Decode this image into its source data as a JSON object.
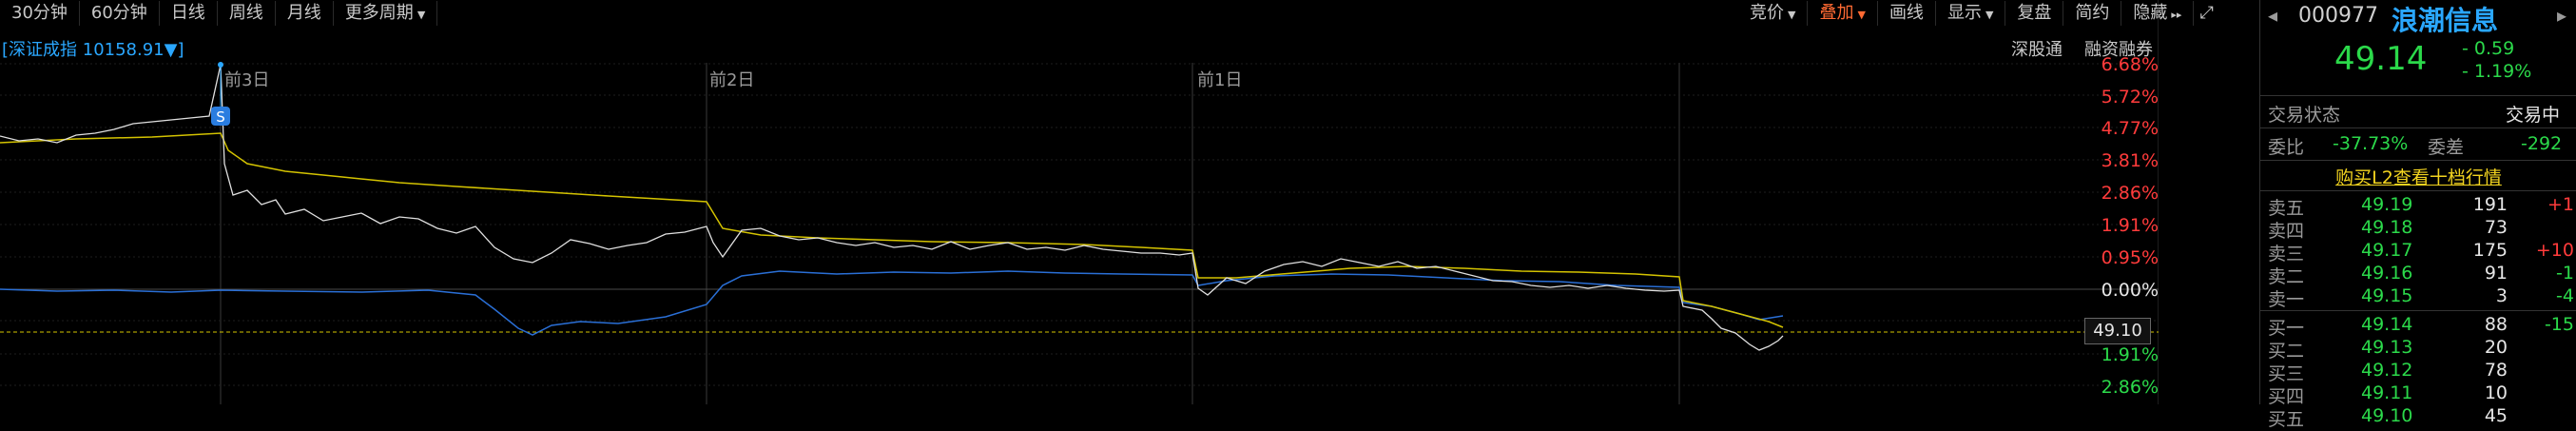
{
  "toolbar_left": [
    "30分钟",
    "60分钟",
    "日线",
    "周线",
    "月线",
    "更多周期"
  ],
  "toolbar_right": [
    "竞价",
    "叠加",
    "画线",
    "显示",
    "复盘",
    "简约",
    "隐藏"
  ],
  "index_label": "[深证成指 10158.91▼]",
  "links": [
    "深股通",
    "融资融券"
  ],
  "dates": [
    "前3日",
    "前2日",
    "前1日"
  ],
  "signal_marker": "S",
  "price_axis": [
    {
      "text": "6.68%",
      "color": "red"
    },
    {
      "text": "5.72%",
      "color": "red"
    },
    {
      "text": "4.77%",
      "color": "red"
    },
    {
      "text": "3.81%",
      "color": "red"
    },
    {
      "text": "2.86%",
      "color": "red"
    },
    {
      "text": "1.91%",
      "color": "red"
    },
    {
      "text": "0.95%",
      "color": "red"
    },
    {
      "text": "0.00%",
      "color": "white"
    },
    {
      "text": "1.91%",
      "color": "green"
    },
    {
      "text": "2.86%",
      "color": "green"
    }
  ],
  "cursor_price": "49.10",
  "stock": {
    "code": "000977",
    "name": "浪潮信息",
    "price": "49.14",
    "change": "- 0.59",
    "change_pct": "- 1.19%"
  },
  "status": {
    "label": "交易状态",
    "value": "交易中"
  },
  "ratio": {
    "label1": "委比",
    "value1": "-37.73%",
    "label2": "委差",
    "value2": "-292"
  },
  "l2_banner": "购买L2查看十档行情",
  "sells": [
    {
      "label": "卖五",
      "price": "49.19",
      "vol": "191",
      "chg": "+1"
    },
    {
      "label": "卖四",
      "price": "49.18",
      "vol": "73",
      "chg": ""
    },
    {
      "label": "卖三",
      "price": "49.17",
      "vol": "175",
      "chg": "+10"
    },
    {
      "label": "卖二",
      "price": "49.16",
      "vol": "91",
      "chg": "-1"
    },
    {
      "label": "卖一",
      "price": "49.15",
      "vol": "3",
      "chg": "-4"
    }
  ],
  "buys": [
    {
      "label": "买一",
      "price": "49.14",
      "vol": "88",
      "chg": "-15"
    },
    {
      "label": "买二",
      "price": "49.13",
      "vol": "20",
      "chg": ""
    },
    {
      "label": "买三",
      "price": "49.12",
      "vol": "78",
      "chg": ""
    },
    {
      "label": "买四",
      "price": "49.11",
      "vol": "10",
      "chg": ""
    },
    {
      "label": "买五",
      "price": "49.10",
      "vol": "45",
      "chg": ""
    }
  ],
  "colors": {
    "up": "#ff3b3b",
    "down": "#2bd94a",
    "accent": "#ff6a33",
    "brand": "#2aa7ff",
    "avg": "#d4c300",
    "index": "#2a6fd6"
  }
}
